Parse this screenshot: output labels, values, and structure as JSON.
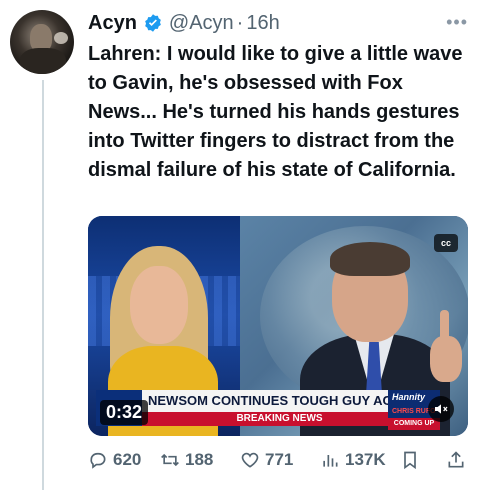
{
  "author": {
    "name": "Acyn",
    "handle": "@Acyn",
    "separator": "·",
    "time": "16h",
    "verified": true
  },
  "tweet": {
    "text": "Lahren: I would like to give a little wave to Gavin, he's obsessed with Fox News... He's turned his hands gestures into Twitter fingers to distract from the dismal failure of his state of California."
  },
  "media": {
    "cc_label": "cc",
    "duration": "0:32",
    "headline": "NEWSOM CONTINUES TOUGH GUY ACT",
    "banner": "BREAKING NEWS",
    "show": "Hannity",
    "show_sub": "CHRIS RUFO",
    "show_coming": "COMING UP"
  },
  "metrics": {
    "replies": "620",
    "retweets": "188",
    "likes": "771",
    "views": "137K"
  },
  "colors": {
    "text": "#0f1419",
    "secondary": "#536471",
    "verified": "#1d9bf0",
    "fox_red": "#c8102e"
  }
}
